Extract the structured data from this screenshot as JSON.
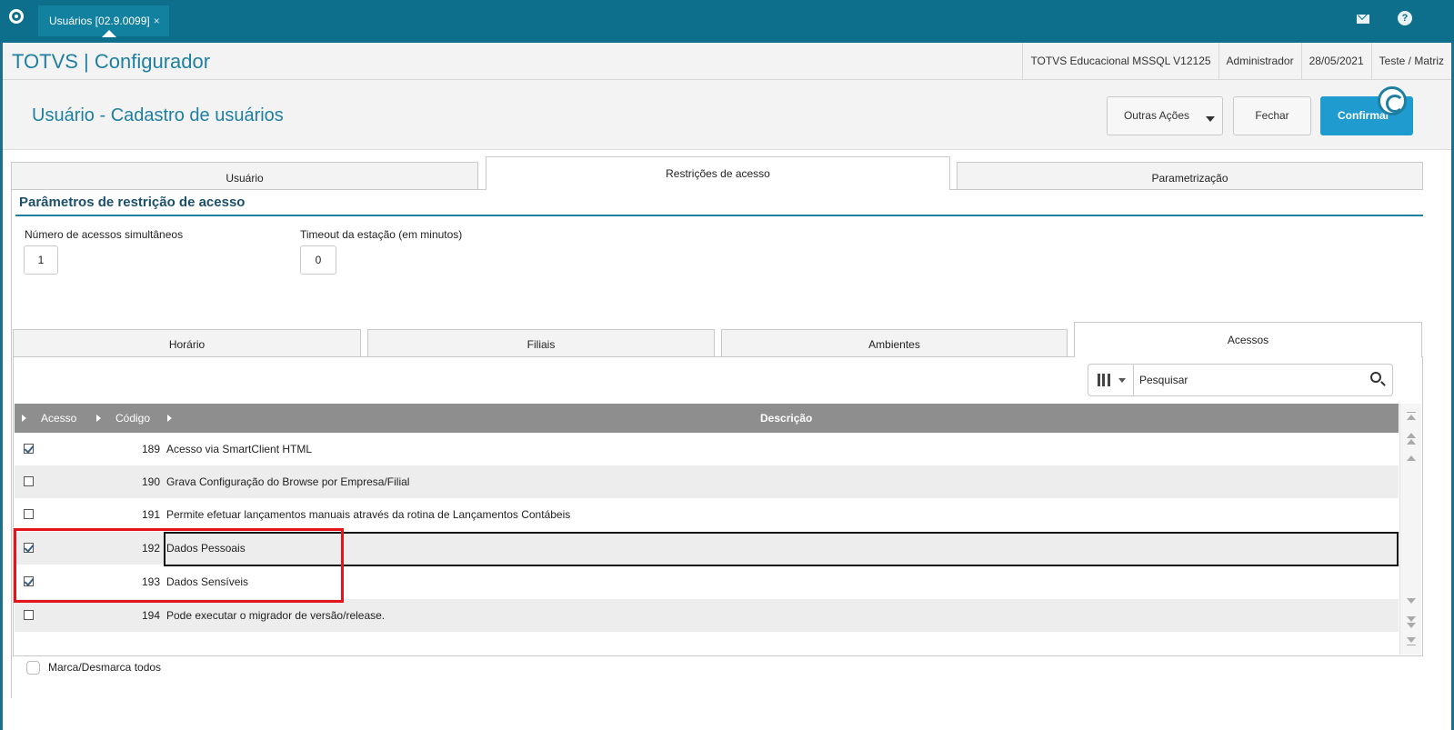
{
  "topbar": {
    "tab_label": "Usuários [02.9.0099]",
    "tab_close": "×",
    "accent": "#0e6f8c"
  },
  "titlebar": {
    "app_title": "TOTVS | Configurador",
    "environment": "TOTVS Educacional MSSQL V12125",
    "user": "Administrador",
    "date": "28/05/2021",
    "company": "Teste / Matriz"
  },
  "header": {
    "page_title": "Usuário - Cadastro de usuários",
    "buttons": {
      "other_actions": "Outras Ações",
      "close": "Fechar",
      "confirm": "Confirmar"
    }
  },
  "main_tabs": [
    {
      "label": "Usuário",
      "active": false
    },
    {
      "label": "Restrições de acesso",
      "active": true
    },
    {
      "label": "Parametrização",
      "active": false
    }
  ],
  "section": {
    "title": "Parâmetros de restrição de acesso",
    "fields": {
      "simultaneous_label": "Número de acessos simultâneos",
      "simultaneous_value": "1",
      "timeout_label": "Timeout da estação (em minutos)",
      "timeout_value": "0"
    }
  },
  "sub_tabs": [
    {
      "label": "Horário",
      "active": false
    },
    {
      "label": "Filiais",
      "active": false
    },
    {
      "label": "Ambientes",
      "active": false
    },
    {
      "label": "Acessos",
      "active": true
    }
  ],
  "search": {
    "placeholder": "Pesquisar"
  },
  "grid": {
    "columns": [
      "Acesso",
      "Código",
      "Descrição"
    ],
    "rows": [
      {
        "checked": true,
        "code": "189",
        "description": "Acesso via SmartClient HTML"
      },
      {
        "checked": false,
        "code": "190",
        "description": "Grava Configuração do Browse por Empresa/Filial"
      },
      {
        "checked": false,
        "code": "191",
        "description": "Permite efetuar lançamentos manuais através da rotina de Lançamentos Contábeis"
      },
      {
        "checked": true,
        "code": "192",
        "description": "Dados Pessoais"
      },
      {
        "checked": true,
        "code": "193",
        "description": "Dados Sensíveis"
      },
      {
        "checked": false,
        "code": "194",
        "description": "Pode executar o migrador de versão/release."
      }
    ]
  },
  "footer": {
    "mark_all_label": "Marca/Desmarca todos"
  },
  "colors": {
    "primary": "#1f7fa0",
    "confirm": "#1f9bd0",
    "highlight": "#e3151b"
  }
}
